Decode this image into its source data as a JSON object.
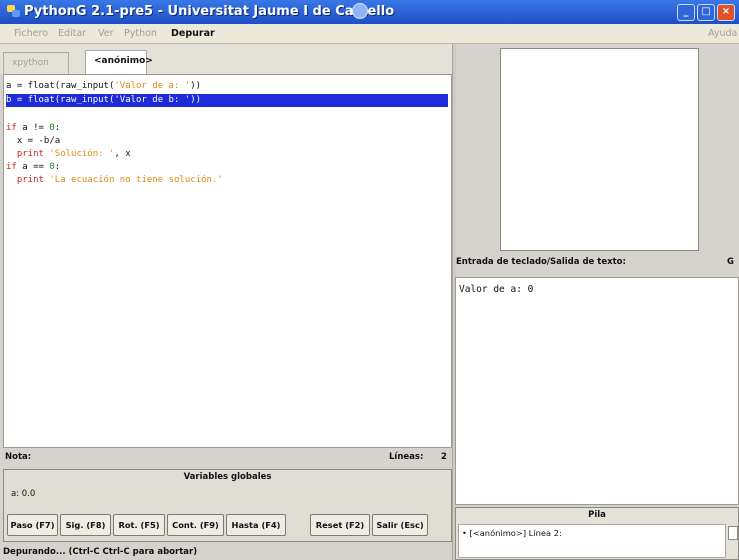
{
  "window": {
    "title": "PythonG 2.1-pre5 - Universitat Jaume I de Castello"
  },
  "menu": {
    "items": [
      "Fichero",
      "Editar",
      "Ver",
      "Python",
      "Depurar"
    ],
    "right": "Ayuda"
  },
  "tabs": [
    "xpython",
    "<anónimo>"
  ],
  "editor": {
    "lines": [
      "a = float(raw_input('Valor de a: '))",
      "b = float(raw_input('Valor de b: '))",
      "",
      "if a != 0:",
      "  x = -b/a",
      "  print 'Solución: ', x",
      "if a == 0:",
      "  print 'La ecuación no tiene solución.'"
    ]
  },
  "status": {
    "note_label": "Nota:",
    "lines_label": "Líneas:",
    "lines_value": "2"
  },
  "globals": {
    "header": "Variables globales",
    "entry": "a: 0.0"
  },
  "buttons": [
    "Paso (F7)",
    "Sig. (F8)",
    "Rot. (F5)",
    "Cont. (F9)",
    "Hasta (F4)",
    "Reset (F2)",
    "Salir (Esc)"
  ],
  "bottom_status": "Depurando... (Ctrl-C Ctrl-C para abortar)",
  "io": {
    "label": "Entrada de teclado/Salida de texto:",
    "tab": "G",
    "output": "Valor de a: 0"
  },
  "stack": {
    "header": "Pila",
    "entry": "• [<anónimo>] Línea 2:"
  },
  "colors": {
    "titlebar": "#2a62d6",
    "selection": "#1d2bd8",
    "keyword": "#c8241a",
    "string": "#e08a14",
    "number": "#1a8a1a"
  }
}
